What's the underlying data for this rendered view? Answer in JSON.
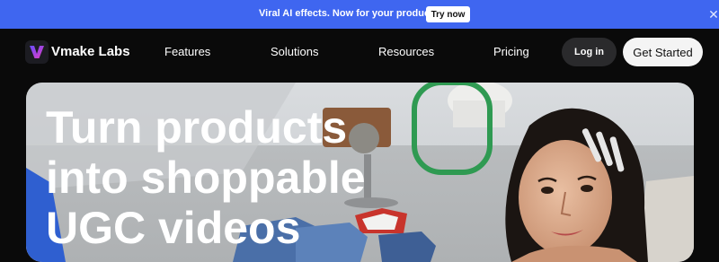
{
  "promo": {
    "text": "Viral AI effects. Now for your products.",
    "button_label": "Try now",
    "close_icon": "close-icon",
    "background": "#3f66f0"
  },
  "nav": {
    "brand": "Vmake Labs",
    "logo_icon": "v-logo-icon",
    "links": [
      "Features",
      "Solutions",
      "Resources",
      "Pricing"
    ],
    "login_label": "Log in",
    "cta_label": "Get Started"
  },
  "hero": {
    "title_lines": [
      "Turn products",
      "into shoppable",
      "UGC videos"
    ],
    "image": "hero-photo-woman-with-products"
  }
}
